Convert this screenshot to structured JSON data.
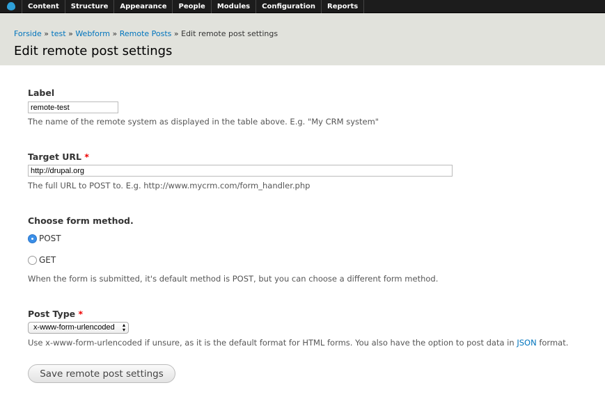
{
  "toolbar": {
    "items": [
      "Content",
      "Structure",
      "Appearance",
      "People",
      "Modules",
      "Configuration",
      "Reports"
    ]
  },
  "breadcrumb": {
    "items": [
      "Forside",
      "test",
      "Webform",
      "Remote Posts"
    ],
    "sep": "»",
    "current": "Edit remote post settings"
  },
  "page_title": "Edit remote post settings",
  "form": {
    "label": {
      "title": "Label",
      "value": "remote-test",
      "desc": "The name of the remote system as displayed in the table above. E.g. \"My CRM system\""
    },
    "target_url": {
      "title": "Target URL",
      "required": "*",
      "value": "http://drupal.org",
      "desc": "The full URL to POST to. E.g. http://www.mycrm.com/form_handler.php"
    },
    "method": {
      "title": "Choose form method.",
      "options": [
        "POST",
        "GET"
      ],
      "selected": "POST",
      "desc": "When the form is submitted, it's default method is POST, but you can choose a different form method."
    },
    "post_type": {
      "title": "Post Type",
      "required": "*",
      "value": "x-www-form-urlencoded",
      "desc_before": "Use x-www-form-urlencoded if unsure, as it is the default format for HTML forms. You also have the option to post data in ",
      "desc_link": "JSON",
      "desc_after": " format."
    },
    "save_label": "Save remote post settings"
  }
}
